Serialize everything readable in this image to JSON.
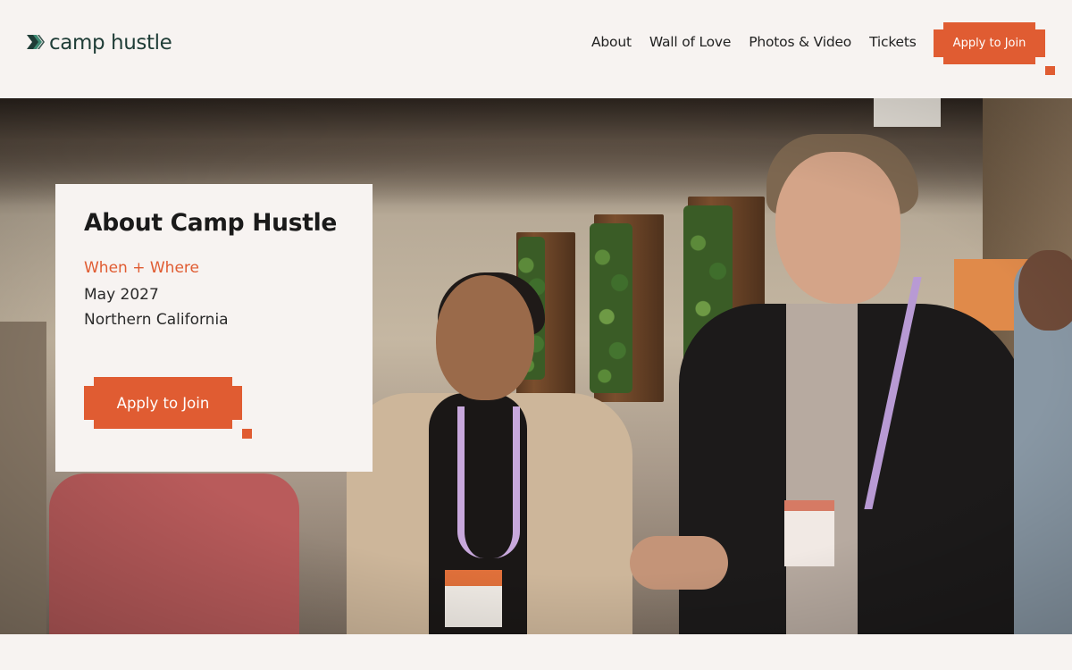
{
  "header": {
    "logo_text": "camp hustle",
    "logo_icon": "double-chevron-logo-icon",
    "nav": [
      {
        "label": "About"
      },
      {
        "label": "Wall of Love"
      },
      {
        "label": "Photos & Video"
      },
      {
        "label": "Tickets"
      }
    ],
    "cta_label": "Apply to Join"
  },
  "hero": {
    "image": "photo of attendees chatting at an indoor event"
  },
  "card": {
    "title": "About Camp Hustle",
    "subtitle": "When + Where",
    "date": "May 2027",
    "location": "Northern California",
    "cta_label": "Apply to Join"
  },
  "colors": {
    "accent": "#e05c32",
    "brand_dark": "#1f3d37",
    "background": "#f7f3f1"
  }
}
